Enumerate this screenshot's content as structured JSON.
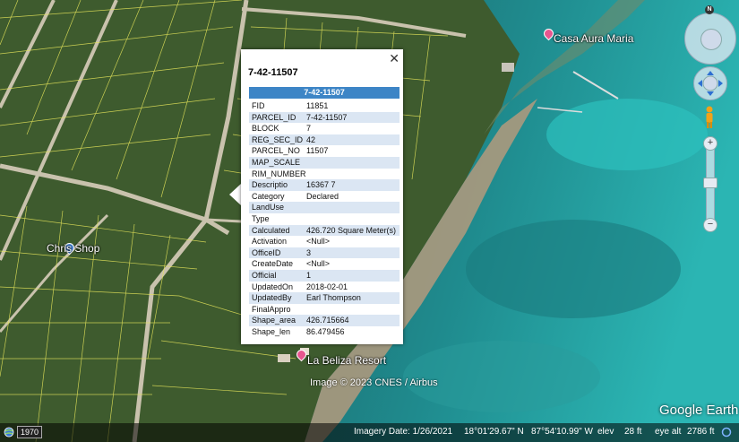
{
  "map": {
    "places": {
      "casa": "Casa Aura Maria",
      "chris": "Chris Shop",
      "resort": "La Beliza Resort"
    },
    "attribution": "Image © 2023 CNES / Airbus",
    "logo": "Google Earth"
  },
  "popup": {
    "title": "7-42-11507",
    "table_header": "7-42-11507",
    "close_icon": "close-icon",
    "rows": [
      {
        "key": "FID",
        "value": "11851"
      },
      {
        "key": "PARCEL_ID",
        "value": "7-42-11507"
      },
      {
        "key": "BLOCK",
        "value": "7"
      },
      {
        "key": "REG_SEC_ID",
        "value": "42"
      },
      {
        "key": "PARCEL_NO",
        "value": "11507"
      },
      {
        "key": "MAP_SCALE",
        "value": ""
      },
      {
        "key": "RIM_NUMBER",
        "value": ""
      },
      {
        "key": "Descriptio",
        "value": "16367 7"
      },
      {
        "key": "Category",
        "value": "Declared"
      },
      {
        "key": "LandUse",
        "value": ""
      },
      {
        "key": "Type",
        "value": ""
      },
      {
        "key": "Calculated",
        "value": "426.720 Square Meter(s)"
      },
      {
        "key": "Activation",
        "value": "<Null>"
      },
      {
        "key": "OfficeID",
        "value": "3"
      },
      {
        "key": "CreateDate",
        "value": "<Null>"
      },
      {
        "key": "Official",
        "value": "1"
      },
      {
        "key": "UpdatedOn",
        "value": "2018-02-01"
      },
      {
        "key": "UpdatedBy",
        "value": "Earl Thompson"
      },
      {
        "key": "FinalAppro",
        "value": ""
      },
      {
        "key": "Shape_area",
        "value": "426.715664"
      },
      {
        "key": "Shape_len",
        "value": "86.479456"
      }
    ]
  },
  "navigation": {
    "north": "N",
    "zoom_in": "+",
    "zoom_out": "−",
    "zoom_mid": "−"
  },
  "status": {
    "scale": "1970",
    "imagery_date": "Imagery Date: 1/26/2021",
    "lat": "18°01'29.67\" N",
    "lon": "87°54'10.99\" W",
    "elev_label": "elev",
    "elev": "28 ft",
    "eye_label": "eye alt",
    "eye": "2786 ft"
  },
  "colors": {
    "land": "#3d5a2c",
    "water_shallow": "#2fb3b0",
    "water_deep": "#1a6f77",
    "sand": "#b59a78",
    "parcel_lines": "#e3e35a",
    "table_header": "#3d85c6"
  }
}
